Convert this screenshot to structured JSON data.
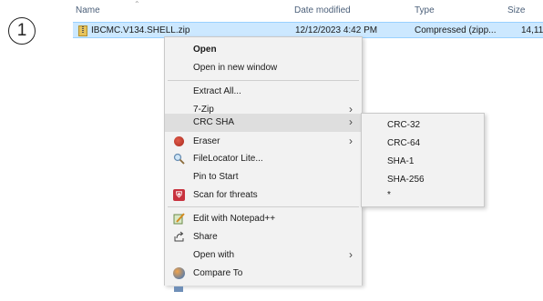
{
  "step_number": "1",
  "columns": {
    "name": "Name",
    "date_modified": "Date modified",
    "type": "Type",
    "size": "Size"
  },
  "file": {
    "name": "IBCMC.V134.SHELL.zip",
    "date_modified": "12/12/2023 4:42 PM",
    "type": "Compressed (zipp...",
    "size": "14,11",
    "icon": "zip-folder-icon"
  },
  "context_menu": {
    "items": [
      {
        "label": "Open",
        "bold": true
      },
      {
        "label": "Open in new window"
      },
      {
        "label": "Extract All..."
      },
      {
        "label": "7-Zip",
        "submenu": true
      },
      {
        "label": "CRC SHA",
        "submenu": true,
        "highlighted": true
      },
      {
        "label": "Eraser",
        "submenu": true,
        "icon": "eraser-icon"
      },
      {
        "label": "FileLocator Lite...",
        "icon": "magnifier-icon"
      },
      {
        "label": "Pin to Start"
      },
      {
        "label": "Scan for threats",
        "icon": "shield-icon"
      },
      {
        "label": "Edit with Notepad++",
        "icon": "notepad-icon"
      },
      {
        "label": "Share",
        "icon": "share-icon"
      },
      {
        "label": "Open with",
        "submenu": true
      },
      {
        "label": "Compare To",
        "icon": "compare-icon"
      }
    ]
  },
  "crc_submenu": {
    "items": [
      {
        "label": "CRC-32"
      },
      {
        "label": "CRC-64"
      },
      {
        "label": "SHA-1"
      },
      {
        "label": "SHA-256"
      },
      {
        "label": "*"
      }
    ]
  },
  "colors": {
    "selection": "#cce8ff",
    "menu_bg": "#f2f2f2",
    "menu_hover": "#dedede"
  }
}
